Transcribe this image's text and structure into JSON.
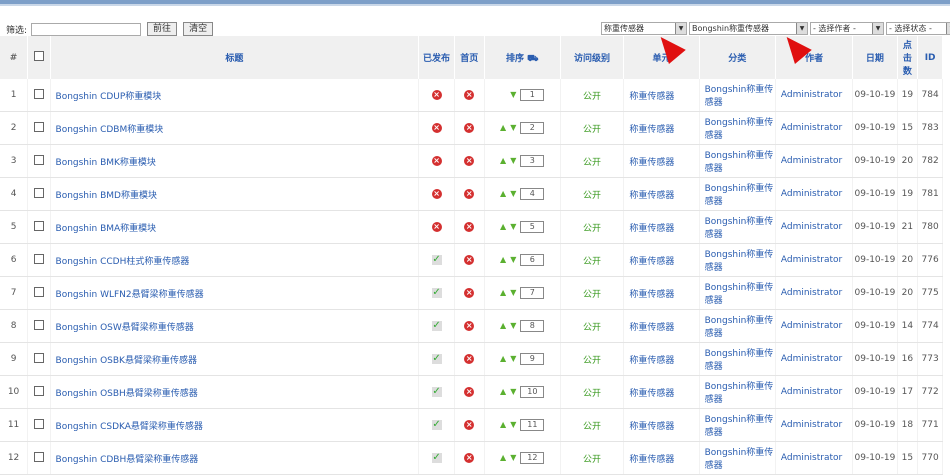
{
  "filter": {
    "label": "筛选:",
    "value": "",
    "go": "前往",
    "reset": "清空"
  },
  "selects": [
    "称重传感器",
    "Bongshin称重传感器",
    "- 选择作者 -",
    "- 选择状态 -"
  ],
  "headers": [
    "#",
    "",
    "标题",
    "已发布",
    "首页",
    "排序",
    "访问级别",
    "单元",
    "分类",
    "作者",
    "日期",
    "点击数",
    "ID"
  ],
  "rows": [
    {
      "n": "1",
      "title": "Bongshin CDUP称重模块",
      "pub": false,
      "front": false,
      "up": false,
      "order": "1",
      "access": "公开",
      "section": "称重传感器",
      "category": "Bongshin称重传感器",
      "author": "Administrator",
      "date": "09-10-19",
      "hits": "19",
      "id": "784"
    },
    {
      "n": "2",
      "title": "Bongshin CDBM称重模块",
      "pub": false,
      "front": false,
      "up": true,
      "order": "2",
      "access": "公开",
      "section": "称重传感器",
      "category": "Bongshin称重传感器",
      "author": "Administrator",
      "date": "09-10-19",
      "hits": "15",
      "id": "783"
    },
    {
      "n": "3",
      "title": "Bongshin BMK称重模块",
      "pub": false,
      "front": false,
      "up": true,
      "order": "3",
      "access": "公开",
      "section": "称重传感器",
      "category": "Bongshin称重传感器",
      "author": "Administrator",
      "date": "09-10-19",
      "hits": "20",
      "id": "782"
    },
    {
      "n": "4",
      "title": "Bongshin BMD称重模块",
      "pub": false,
      "front": false,
      "up": true,
      "order": "4",
      "access": "公开",
      "section": "称重传感器",
      "category": "Bongshin称重传感器",
      "author": "Administrator",
      "date": "09-10-19",
      "hits": "19",
      "id": "781"
    },
    {
      "n": "5",
      "title": "Bongshin BMA称重模块",
      "pub": false,
      "front": false,
      "up": true,
      "order": "5",
      "access": "公开",
      "section": "称重传感器",
      "category": "Bongshin称重传感器",
      "author": "Administrator",
      "date": "09-10-19",
      "hits": "21",
      "id": "780"
    },
    {
      "n": "6",
      "title": "Bongshin CCDH柱式称重传感器",
      "pub": true,
      "front": false,
      "up": true,
      "order": "6",
      "access": "公开",
      "section": "称重传感器",
      "category": "Bongshin称重传感器",
      "author": "Administrator",
      "date": "09-10-19",
      "hits": "20",
      "id": "776"
    },
    {
      "n": "7",
      "title": "Bongshin WLFN2悬臂梁称重传感器",
      "pub": true,
      "front": false,
      "up": true,
      "order": "7",
      "access": "公开",
      "section": "称重传感器",
      "category": "Bongshin称重传感器",
      "author": "Administrator",
      "date": "09-10-19",
      "hits": "20",
      "id": "775"
    },
    {
      "n": "8",
      "title": "Bongshin OSW悬臂梁称重传感器",
      "pub": true,
      "front": false,
      "up": true,
      "order": "8",
      "access": "公开",
      "section": "称重传感器",
      "category": "Bongshin称重传感器",
      "author": "Administrator",
      "date": "09-10-19",
      "hits": "14",
      "id": "774"
    },
    {
      "n": "9",
      "title": "Bongshin OSBK悬臂梁称重传感器",
      "pub": true,
      "front": false,
      "up": true,
      "order": "9",
      "access": "公开",
      "section": "称重传感器",
      "category": "Bongshin称重传感器",
      "author": "Administrator",
      "date": "09-10-19",
      "hits": "16",
      "id": "773"
    },
    {
      "n": "10",
      "title": "Bongshin OSBH悬臂梁称重传感器",
      "pub": true,
      "front": false,
      "up": true,
      "order": "10",
      "access": "公开",
      "section": "称重传感器",
      "category": "Bongshin称重传感器",
      "author": "Administrator",
      "date": "09-10-19",
      "hits": "17",
      "id": "772"
    },
    {
      "n": "11",
      "title": "Bongshin CSDKA悬臂梁称重传感器",
      "pub": true,
      "front": false,
      "up": true,
      "order": "11",
      "access": "公开",
      "section": "称重传感器",
      "category": "Bongshin称重传感器",
      "author": "Administrator",
      "date": "09-10-19",
      "hits": "18",
      "id": "771"
    },
    {
      "n": "12",
      "title": "Bongshin CDBH悬臂梁称重传感器",
      "pub": true,
      "front": false,
      "up": true,
      "order": "12",
      "access": "公开",
      "section": "称重传感器",
      "category": "Bongshin称重传感器",
      "author": "Administrator",
      "date": "09-10-19",
      "hits": "15",
      "id": "770"
    }
  ]
}
